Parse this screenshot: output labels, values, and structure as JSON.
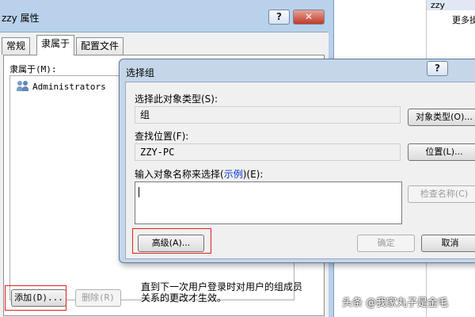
{
  "props_window": {
    "title": "zzy 属性",
    "help_glyph": "?",
    "close_glyph": "✕",
    "tabs": [
      {
        "label": "常规",
        "active": false
      },
      {
        "label": "隶属于",
        "active": true
      },
      {
        "label": "配置文件",
        "active": false
      }
    ],
    "member_of_label": "隶属于(M):",
    "members": [
      "Administrators"
    ],
    "add_button": "添加(D)...",
    "remove_button": "删除(R)",
    "note": "直到下一次用户登录时对用户的组成员关系的更改才生效。"
  },
  "right_strip": {
    "header": "zzy",
    "more": "更多操"
  },
  "select_group_dialog": {
    "title": "选择组",
    "help_glyph": "?",
    "object_type_label": "选择此对象类型(S):",
    "object_type_value": "组",
    "object_types_button": "对象类型(O)...",
    "location_label": "查找位置(F):",
    "location_value": "ZZY-PC",
    "location_button": "位置(L)...",
    "enter_names_label_pre": "输入对象名称来选择(",
    "examples_link": "示例",
    "enter_names_label_post": ")(E):",
    "names_input_value": "",
    "check_names_button": "检查名称(C)",
    "advanced_button": "高级(A)...",
    "ok_button": "确定",
    "cancel_button": "取消"
  },
  "watermark": "头条 @我家丸子是金毛",
  "colors": {
    "highlight_box": "#e02020",
    "link": "#0033cc",
    "title_bar": "#b9d1ea"
  }
}
